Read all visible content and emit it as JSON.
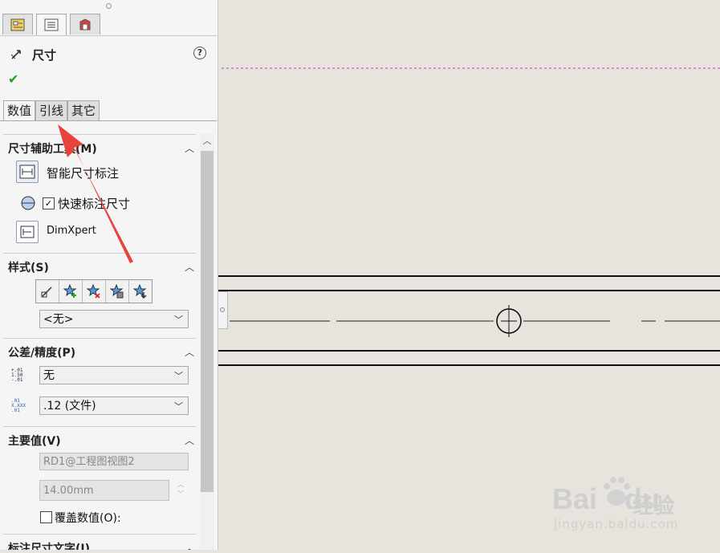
{
  "panel": {
    "title": "尺寸",
    "help": "?",
    "ok": "✔",
    "tabs": [
      "数值",
      "引线",
      "其它"
    ]
  },
  "tools": {
    "title": "尺寸辅助工具(M)",
    "smart": "智能尺寸标注",
    "quick": "快速标注尺寸",
    "quick_checked": true,
    "dimxpert": "DimXpert"
  },
  "style": {
    "title": "样式(S)",
    "value": "<无>"
  },
  "tolerance": {
    "title": "公差/精度(P)",
    "tol_value": "无",
    "precision_value": ".12 (文件)",
    "tol_icon_text": "+.01\n1.50\n-.01",
    "prec_icon_text": ".01\nX.XXX\n.01"
  },
  "primary": {
    "title": "主要值(V)",
    "name": "RD1@工程图视图2",
    "value": "14.00mm",
    "override": "覆盖数值(O):"
  },
  "dimtext": {
    "title": "标注尺寸文字(I)"
  },
  "watermark": {
    "brand": "Bai",
    "brand2": "du",
    "site": "经验",
    "url": "jingyan.baidu.com"
  },
  "colors": {
    "arrow": "#e8423c",
    "sketch_line": "#d030d0"
  }
}
